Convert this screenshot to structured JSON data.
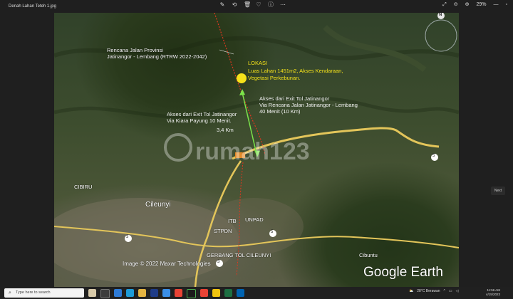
{
  "window": {
    "title": "Denah Lahan Teteh 1.jpg"
  },
  "toolbar": {
    "icons": [
      "edit-icon",
      "rotate-icon",
      "delete-icon",
      "heart-icon",
      "info-icon",
      "more-icon"
    ],
    "zoom_label": "29%"
  },
  "map": {
    "annotations": {
      "rencana": [
        "Rencana Jalan Provinsi",
        "Jatinangor - Lembang (RTRW 2022-2042)"
      ],
      "lokasi_title": "LOKASI",
      "lokasi_desc": [
        "Luas Lahan 1451m2, Akses Kendaraan,",
        "Vegetasi Perkebunan."
      ],
      "akses_rencana": [
        "Akses dari Exit Tol Jatinangor",
        "Via Rencana Jalan Jatinangor - Lembang",
        "40 Menit    (10 Km)"
      ],
      "akses_kiara": [
        "Akses dari Exit Tol Jatinangor",
        "Via Kiara Payung 10 Menit."
      ],
      "distance": "3,4 Km",
      "places": {
        "cibiru": "CIBIRU",
        "cileunyi": "Cileunyi",
        "itb": "ITB",
        "unpad": "UNPAD",
        "stpdn": "STPDN",
        "gerbang": "GERBANG TOL CILEUNYI",
        "cibuntu": "Cibuntu"
      },
      "road_badges": [
        "5",
        "5",
        "3",
        "3"
      ],
      "credit": "Image © 2022 Maxar Technologies",
      "watermark": "rumah123",
      "brand": "Google Earth",
      "compass": "N"
    },
    "colors": {
      "label_white": "#f2f2f2",
      "label_yellow": "#f5e21a",
      "arrow_green": "#7be34a",
      "road_planned": "#e0371f",
      "road_main": "#e3c55a"
    }
  },
  "nav": {
    "next_label": "Next"
  },
  "taskbar": {
    "search_placeholder": "Type here to search",
    "weather": "28°C  Berawan",
    "time": "11:56 AM",
    "date": "4/15/2023"
  }
}
